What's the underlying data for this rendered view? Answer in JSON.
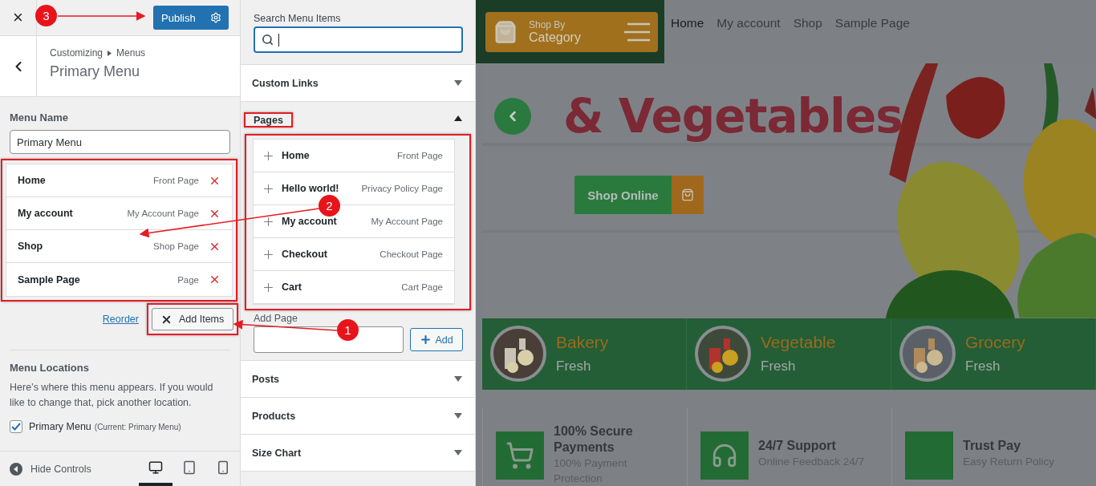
{
  "customizer": {
    "close": "×",
    "publish": "Publish",
    "breadcrumb": [
      "Customizing",
      "Menus"
    ],
    "title": "Primary Menu",
    "menu_name": {
      "label": "Menu Name",
      "value": "Primary Menu"
    },
    "menu_items": {
      "highlighted": true,
      "items": [
        {
          "title": "Home",
          "type": "Front Page"
        },
        {
          "title": "My account",
          "type": "My Account Page"
        },
        {
          "title": "Shop",
          "type": "Shop Page"
        },
        {
          "title": "Sample Page",
          "type": "Page"
        }
      ]
    },
    "reorder": "Reorder",
    "add_items": {
      "label": "Add Items",
      "highlighted": true
    },
    "locations": {
      "heading": "Menu Locations",
      "description": "Here’s where this menu appears. If you would like to change that, pick another location.",
      "checkbox": {
        "label": "Primary Menu",
        "note": "(Current: Primary Menu)",
        "checked": true
      }
    },
    "footer": {
      "hide_controls": "Hide Controls",
      "devices": [
        {
          "kind": "desktop",
          "selected": true
        },
        {
          "kind": "tablet",
          "selected": false
        },
        {
          "kind": "mobile",
          "selected": false
        }
      ]
    }
  },
  "menu_items_panel": {
    "search_label": "Search Menu Items",
    "sections": [
      {
        "title": "Custom Links",
        "expanded": false
      },
      {
        "title": "Pages",
        "expanded": true,
        "highlighted": true,
        "items": [
          {
            "title": "Home",
            "type": "Front Page"
          },
          {
            "title": "Hello world!",
            "type": "Privacy Policy Page"
          },
          {
            "title": "My account",
            "type": "My Account Page"
          },
          {
            "title": "Checkout",
            "type": "Checkout Page"
          },
          {
            "title": "Cart",
            "type": "Cart Page"
          }
        ],
        "add_label": "Add Page",
        "add_button": "Add"
      },
      {
        "title": "Posts",
        "expanded": false
      },
      {
        "title": "Products",
        "expanded": false
      },
      {
        "title": "Size Chart",
        "expanded": false
      }
    ]
  },
  "preview": {
    "category_button": [
      "Shop By",
      "Category"
    ],
    "nav": [
      {
        "label": "Home",
        "selected": true
      },
      {
        "label": "My account",
        "selected": false
      },
      {
        "label": "Shop",
        "selected": false
      },
      {
        "label": "Sample Page",
        "selected": false
      }
    ],
    "hero_title": "& Vegetables",
    "hero_button": "Shop Online",
    "categories": [
      {
        "name": "Bakery",
        "subtitle": "Fresh"
      },
      {
        "name": "Vegetable",
        "subtitle": "Fresh"
      },
      {
        "name": "Grocery",
        "subtitle": "Fresh"
      }
    ],
    "features": [
      {
        "kind": "cart",
        "title": "100% Secure Payments",
        "subtitle": "100% Payment Protection"
      },
      {
        "kind": "headphones",
        "title": "24/7 Support",
        "subtitle": "Online Feedback 24/7"
      },
      {
        "kind": "blank",
        "title": "Trust Pay",
        "subtitle": "Easy Return Policy"
      }
    ]
  },
  "annotations": [
    "1",
    "2",
    "3"
  ]
}
